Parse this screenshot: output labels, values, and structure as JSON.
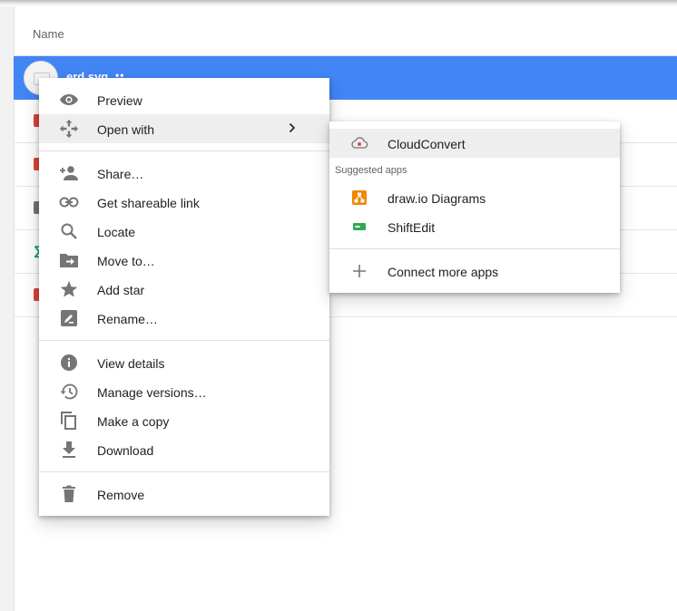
{
  "file_list": {
    "column_name": "Name",
    "selected_file": {
      "name": "erd.svg",
      "shared_marker": "••"
    },
    "row_icon_colors": [
      "#db4437",
      "#db4437",
      "#757575",
      "#0f9d58",
      "#db4437"
    ]
  },
  "context_menu": {
    "preview": "Preview",
    "open_with": "Open with",
    "share": "Share…",
    "get_link": "Get shareable link",
    "locate": "Locate",
    "move_to": "Move to…",
    "add_star": "Add star",
    "rename": "Rename…",
    "view_details": "View details",
    "manage_versions": "Manage versions…",
    "make_copy": "Make a copy",
    "download": "Download",
    "remove": "Remove"
  },
  "open_with_submenu": {
    "cloudconvert": "CloudConvert",
    "suggested_heading": "Suggested apps",
    "drawio": "draw.io Diagrams",
    "shiftedit": "ShiftEdit",
    "connect_more": "Connect more apps"
  },
  "colors": {
    "selection": "#4285f4",
    "menu_icon": "#757575",
    "drawio": "#f08705",
    "shiftedit": "#34a853",
    "cloudconvert": "#e04c3c"
  }
}
